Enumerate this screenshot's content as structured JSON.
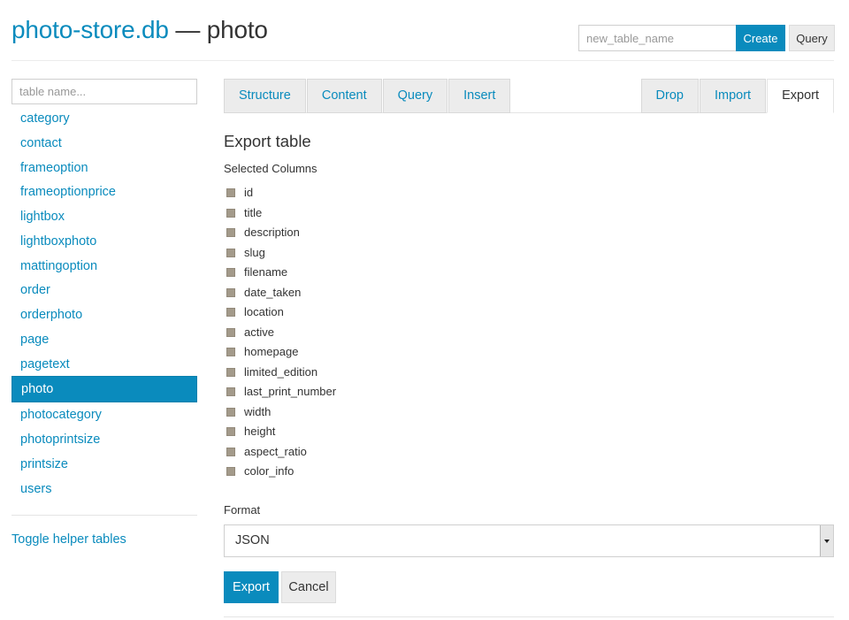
{
  "header": {
    "db_name": "photo-store.db",
    "separator": " — ",
    "table_name": "photo"
  },
  "create": {
    "placeholder": "new_table_name",
    "create_label": "Create",
    "query_label": "Query"
  },
  "sidebar": {
    "filter_placeholder": "table name...",
    "tables": [
      "category",
      "contact",
      "frameoption",
      "frameoptionprice",
      "lightbox",
      "lightboxphoto",
      "mattingoption",
      "order",
      "orderphoto",
      "page",
      "pagetext",
      "photo",
      "photocategory",
      "photoprintsize",
      "printsize",
      "users"
    ],
    "active_table": "photo",
    "toggle_label": "Toggle helper tables"
  },
  "tabs": {
    "left": [
      "Structure",
      "Content",
      "Query",
      "Insert"
    ],
    "right": [
      "Drop",
      "Import",
      "Export"
    ],
    "active": "Export"
  },
  "export": {
    "title": "Export table",
    "columns_label": "Selected Columns",
    "columns": [
      "id",
      "title",
      "description",
      "slug",
      "filename",
      "date_taken",
      "location",
      "active",
      "homepage",
      "limited_edition",
      "last_print_number",
      "width",
      "height",
      "aspect_ratio",
      "color_info"
    ],
    "format_label": "Format",
    "format_value": "JSON",
    "export_label": "Export",
    "cancel_label": "Cancel"
  },
  "colors": {
    "accent": "#0a8bbd",
    "checkbox": "#a39a8a"
  }
}
